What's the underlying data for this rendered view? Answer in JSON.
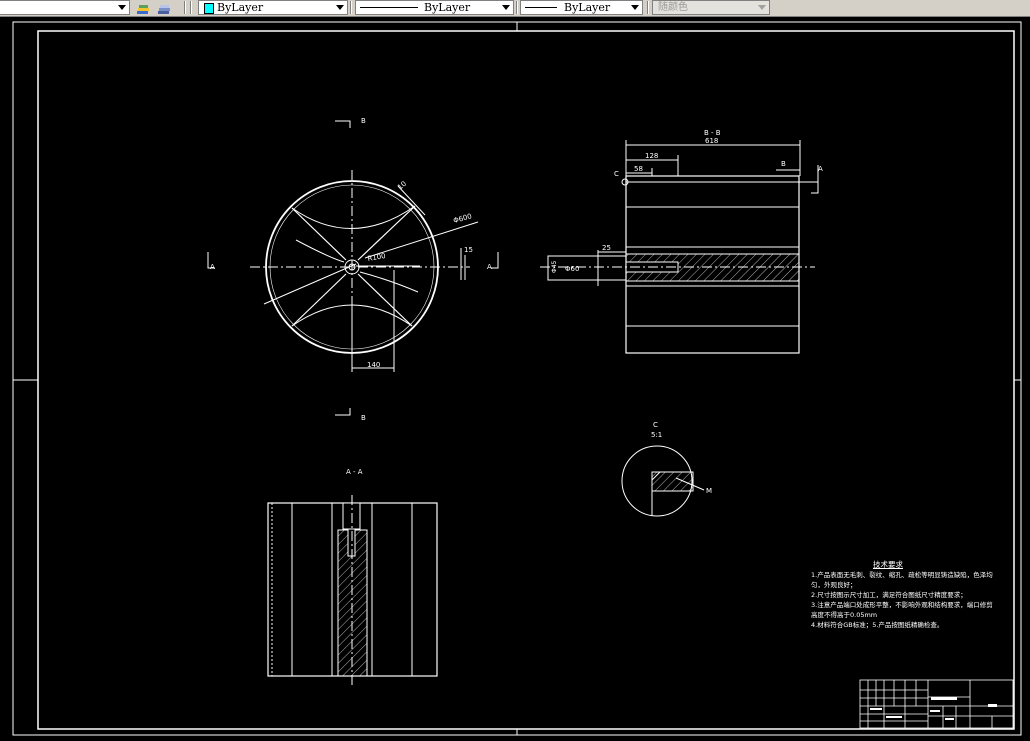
{
  "toolbar": {
    "color_control": "ByLayer",
    "color_swatch": "#00ffff",
    "linetype_control": "ByLayer",
    "lineweight_control": "ByLayer",
    "plotstyle_control": "随颜色",
    "icons": [
      "layer-previous-icon",
      "layer-states-icon"
    ]
  },
  "drawing": {
    "background": "#000000",
    "line_color": "#ffffff",
    "front_view": {
      "label_top": "B",
      "label_bottom": "B",
      "label_left": "A",
      "label_right": "A",
      "dim_top_angle": "10",
      "dim_diameter": "Φ600",
      "dim_radius": "R100",
      "dim_thickness": "15",
      "dim_width": "140"
    },
    "section_bb": {
      "title": "B - B",
      "dim_overall": "618",
      "dim_length": "128",
      "dim_short": "58",
      "dim_small": "25",
      "dim_bore": "Φ45",
      "dim_shaft": "Φ60",
      "detail_marker": "C",
      "label_b": "B",
      "label_a": "A"
    },
    "section_aa": {
      "title": "A - A"
    },
    "detail_c": {
      "title": "C",
      "scale": "5:1",
      "callout": "M"
    },
    "tech_requirements": {
      "heading": "技术要求",
      "lines": [
        "1.产品表面无毛刺、裂纹、缩孔、疏松等明显铸造缺陷，色泽均",
        "匀，外观良好；",
        "2.尺寸按图示尺寸加工，满足符合图纸尺寸精度要求；",
        "3.注意产品端口处成形平整，不影响外观和结构要求，端口修剪",
        "高度不得高于0.05mm",
        "4.材料符合GB标准；5.产品按图纸精确检查。"
      ]
    }
  }
}
